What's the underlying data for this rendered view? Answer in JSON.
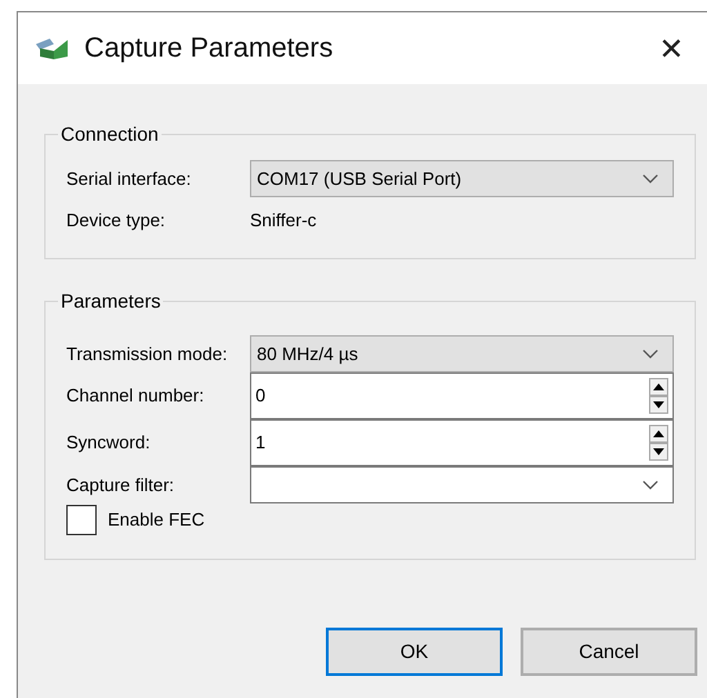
{
  "window": {
    "title": "Capture Parameters",
    "close": "✕"
  },
  "groups": [
    {
      "title": "Connection",
      "rows": [
        {
          "kind": "combo",
          "label": "Serial interface:",
          "value": "COM17 (USB Serial Port)"
        },
        {
          "kind": "text",
          "label": "Device type:",
          "value": "Sniffer-c"
        }
      ]
    },
    {
      "title": "Parameters",
      "rows": [
        {
          "kind": "combo",
          "label": "Transmission mode:",
          "value": "80 MHz/4 µs"
        },
        {
          "kind": "spin",
          "label": "Channel number:",
          "value": "0"
        },
        {
          "kind": "spin",
          "label": "Syncword:",
          "value": "1"
        },
        {
          "kind": "combo",
          "label": "Capture filter:"
        },
        {
          "kind": "checkbox",
          "label": "Enable FEC",
          "checked": false
        }
      ]
    }
  ],
  "buttons": [
    {
      "label": "OK",
      "default": true
    },
    {
      "label": "Cancel",
      "default": false
    }
  ]
}
